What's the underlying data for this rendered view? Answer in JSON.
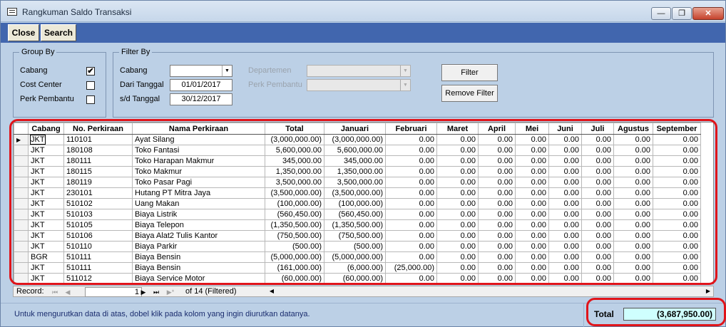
{
  "window": {
    "title": "Rangkuman Saldo Transaksi",
    "min_glyph": "—",
    "max_glyph": "❐",
    "close_glyph": "✕"
  },
  "toolbar": {
    "close_label": "Close",
    "search_label": "Search"
  },
  "group_by": {
    "legend": "Group By",
    "items": [
      {
        "label": "Cabang",
        "checked": "✔"
      },
      {
        "label": "Cost Center",
        "checked": ""
      },
      {
        "label": "Perk Pembantu",
        "checked": ""
      }
    ]
  },
  "filter_by": {
    "legend": "Filter By",
    "cabang_label": "Cabang",
    "cabang_value": "",
    "dari_label": "Dari Tanggal",
    "dari_value": "01/01/2017",
    "sd_label": "s/d Tanggal",
    "sd_value": "30/12/2017",
    "dept_label": "Departemen",
    "perk_label": "Perk Pembantu",
    "filter_button": "Filter",
    "remove_button": "Remove Filter"
  },
  "grid": {
    "columns": [
      "Cabang",
      "No. Perkiraan",
      "Nama Perkiraan",
      "Total",
      "Januari",
      "Februari",
      "Maret",
      "April",
      "Mei",
      "Juni",
      "Juli",
      "Agustus",
      "September"
    ],
    "rows": [
      [
        "JKT",
        "110101",
        "Ayat Silang",
        "(3,000,000.00)",
        "(3,000,000.00)",
        "0.00",
        "0.00",
        "0.00",
        "0.00",
        "0.00",
        "0.00",
        "0.00",
        "0.00"
      ],
      [
        "JKT",
        "180108",
        "Toko Fantasi",
        "5,600,000.00",
        "5,600,000.00",
        "0.00",
        "0.00",
        "0.00",
        "0.00",
        "0.00",
        "0.00",
        "0.00",
        "0.00"
      ],
      [
        "JKT",
        "180111",
        "Toko Harapan Makmur",
        "345,000.00",
        "345,000.00",
        "0.00",
        "0.00",
        "0.00",
        "0.00",
        "0.00",
        "0.00",
        "0.00",
        "0.00"
      ],
      [
        "JKT",
        "180115",
        "Toko Makmur",
        "1,350,000.00",
        "1,350,000.00",
        "0.00",
        "0.00",
        "0.00",
        "0.00",
        "0.00",
        "0.00",
        "0.00",
        "0.00"
      ],
      [
        "JKT",
        "180119",
        "Toko Pasar Pagi",
        "3,500,000.00",
        "3,500,000.00",
        "0.00",
        "0.00",
        "0.00",
        "0.00",
        "0.00",
        "0.00",
        "0.00",
        "0.00"
      ],
      [
        "JKT",
        "230101",
        "Hutang PT Mitra Jaya",
        "(3,500,000.00)",
        "(3,500,000.00)",
        "0.00",
        "0.00",
        "0.00",
        "0.00",
        "0.00",
        "0.00",
        "0.00",
        "0.00"
      ],
      [
        "JKT",
        "510102",
        "Uang Makan",
        "(100,000.00)",
        "(100,000.00)",
        "0.00",
        "0.00",
        "0.00",
        "0.00",
        "0.00",
        "0.00",
        "0.00",
        "0.00"
      ],
      [
        "JKT",
        "510103",
        "Biaya Listrik",
        "(560,450.00)",
        "(560,450.00)",
        "0.00",
        "0.00",
        "0.00",
        "0.00",
        "0.00",
        "0.00",
        "0.00",
        "0.00"
      ],
      [
        "JKT",
        "510105",
        "Biaya Telepon",
        "(1,350,500.00)",
        "(1,350,500.00)",
        "0.00",
        "0.00",
        "0.00",
        "0.00",
        "0.00",
        "0.00",
        "0.00",
        "0.00"
      ],
      [
        "JKT",
        "510106",
        "Biaya Alat2 Tulis Kantor",
        "(750,500.00)",
        "(750,500.00)",
        "0.00",
        "0.00",
        "0.00",
        "0.00",
        "0.00",
        "0.00",
        "0.00",
        "0.00"
      ],
      [
        "JKT",
        "510110",
        "Biaya Parkir",
        "(500.00)",
        "(500.00)",
        "0.00",
        "0.00",
        "0.00",
        "0.00",
        "0.00",
        "0.00",
        "0.00",
        "0.00"
      ],
      [
        "BGR",
        "510111",
        "Biaya Bensin",
        "(5,000,000.00)",
        "(5,000,000.00)",
        "0.00",
        "0.00",
        "0.00",
        "0.00",
        "0.00",
        "0.00",
        "0.00",
        "0.00"
      ],
      [
        "JKT",
        "510111",
        "Biaya Bensin",
        "(161,000.00)",
        "(6,000.00)",
        "(25,000.00)",
        "0.00",
        "0.00",
        "0.00",
        "0.00",
        "0.00",
        "0.00",
        "0.00"
      ],
      [
        "JKT",
        "511012",
        "Biaya Service Motor",
        "(60,000.00)",
        "(60,000.00)",
        "0.00",
        "0.00",
        "0.00",
        "0.00",
        "0.00",
        "0.00",
        "0.00",
        "0.00"
      ]
    ]
  },
  "navigator": {
    "record_label": "Record:",
    "current": "1",
    "of_text": "of  14 (Filtered)"
  },
  "status": {
    "message": "Untuk mengurutkan data di atas, dobel klik pada kolom yang ingin diurutkan datanya.",
    "total_label": "Total",
    "total_value": "(3,687,950.00)"
  },
  "colors": {
    "highlight": "#e0141a",
    "toolbar": "#4166ae",
    "total_bg": "#cffffe"
  }
}
